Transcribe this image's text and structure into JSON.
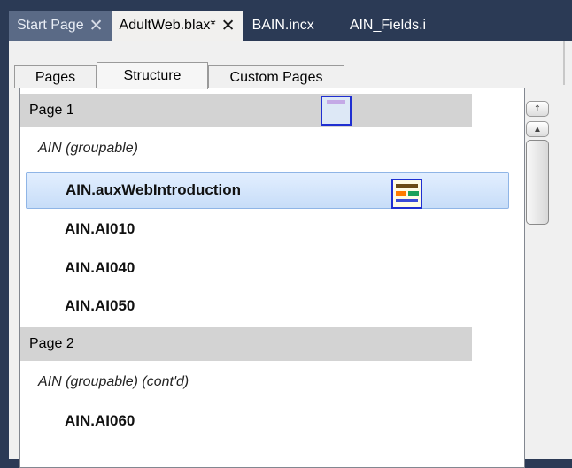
{
  "document_tabs": [
    {
      "label": "Start Page",
      "close": "✕"
    },
    {
      "label": "AdultWeb.blax*",
      "close": "✕"
    },
    {
      "label": "BAIN.incx"
    },
    {
      "label": "AIN_Fields.i"
    }
  ],
  "sub_tabs": [
    "Pages",
    "Structure",
    "Custom Pages"
  ],
  "structure": {
    "page1": "Page 1",
    "group1": "AIN (groupable)",
    "items1": [
      "AIN.auxWebIntroduction",
      "AIN.AI010",
      "AIN.AI040",
      "AIN.AI050"
    ],
    "page2": "Page 2",
    "group2": "AIN (groupable) (cont'd)",
    "items2": [
      "AIN.AI060"
    ]
  },
  "icons": {
    "close": "close-icon",
    "scroll_top": "scroll-top-icon",
    "scroll_up": "scroll-up-icon",
    "page_thumbnail": "page-thumbnail-icon"
  },
  "colors": {
    "accent_selection": "#c7ddf8",
    "page_header": "#d3d3d3",
    "thumbnail_border": "#1f2fd1"
  }
}
